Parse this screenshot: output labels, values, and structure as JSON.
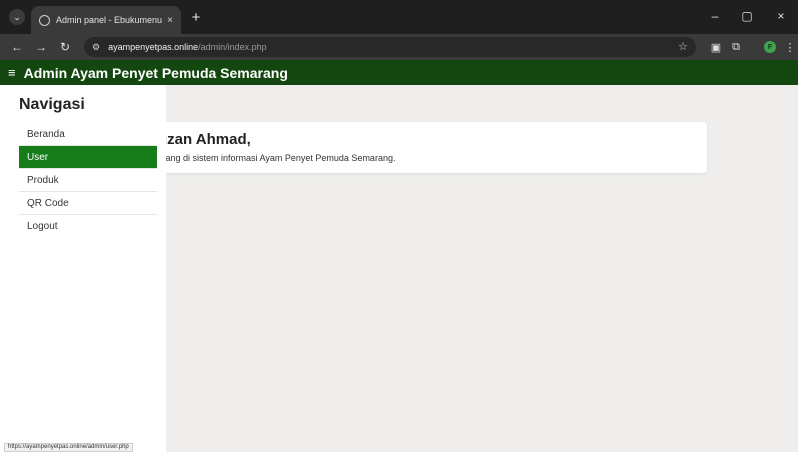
{
  "browser": {
    "tab_title": "Admin panel - Ebukumenu",
    "tab_close": "×",
    "new_tab": "+",
    "url_host": "ayampenyetpas.online",
    "url_path": "/admin/index.php",
    "profile_initial": "F",
    "window_controls": {
      "minimize": "–",
      "restore": "▢",
      "close": "×"
    },
    "nav": {
      "back": "←",
      "forward": "→",
      "reload": "↻"
    }
  },
  "app": {
    "title": "Admin Ayam Penyet Pemuda Semarang",
    "menu_icon": "≡"
  },
  "sidebar": {
    "heading": "Navigasi",
    "items": [
      {
        "label": "Beranda",
        "active": false
      },
      {
        "label": "User",
        "active": true
      },
      {
        "label": "Produk",
        "active": false
      },
      {
        "label": "QR Code",
        "active": false
      },
      {
        "label": "Logout",
        "active": false
      }
    ]
  },
  "main": {
    "greeting": "uzan Ahmad,",
    "message": "atang di sistem informasi Ayam Penyet Pemuda Semarang."
  },
  "status_bar": {
    "url": "https://ayampenyetpas.online/admin/user.php"
  },
  "colors": {
    "appbar": "#13470f",
    "active_nav": "#167c1a",
    "background": "#efeeec"
  }
}
